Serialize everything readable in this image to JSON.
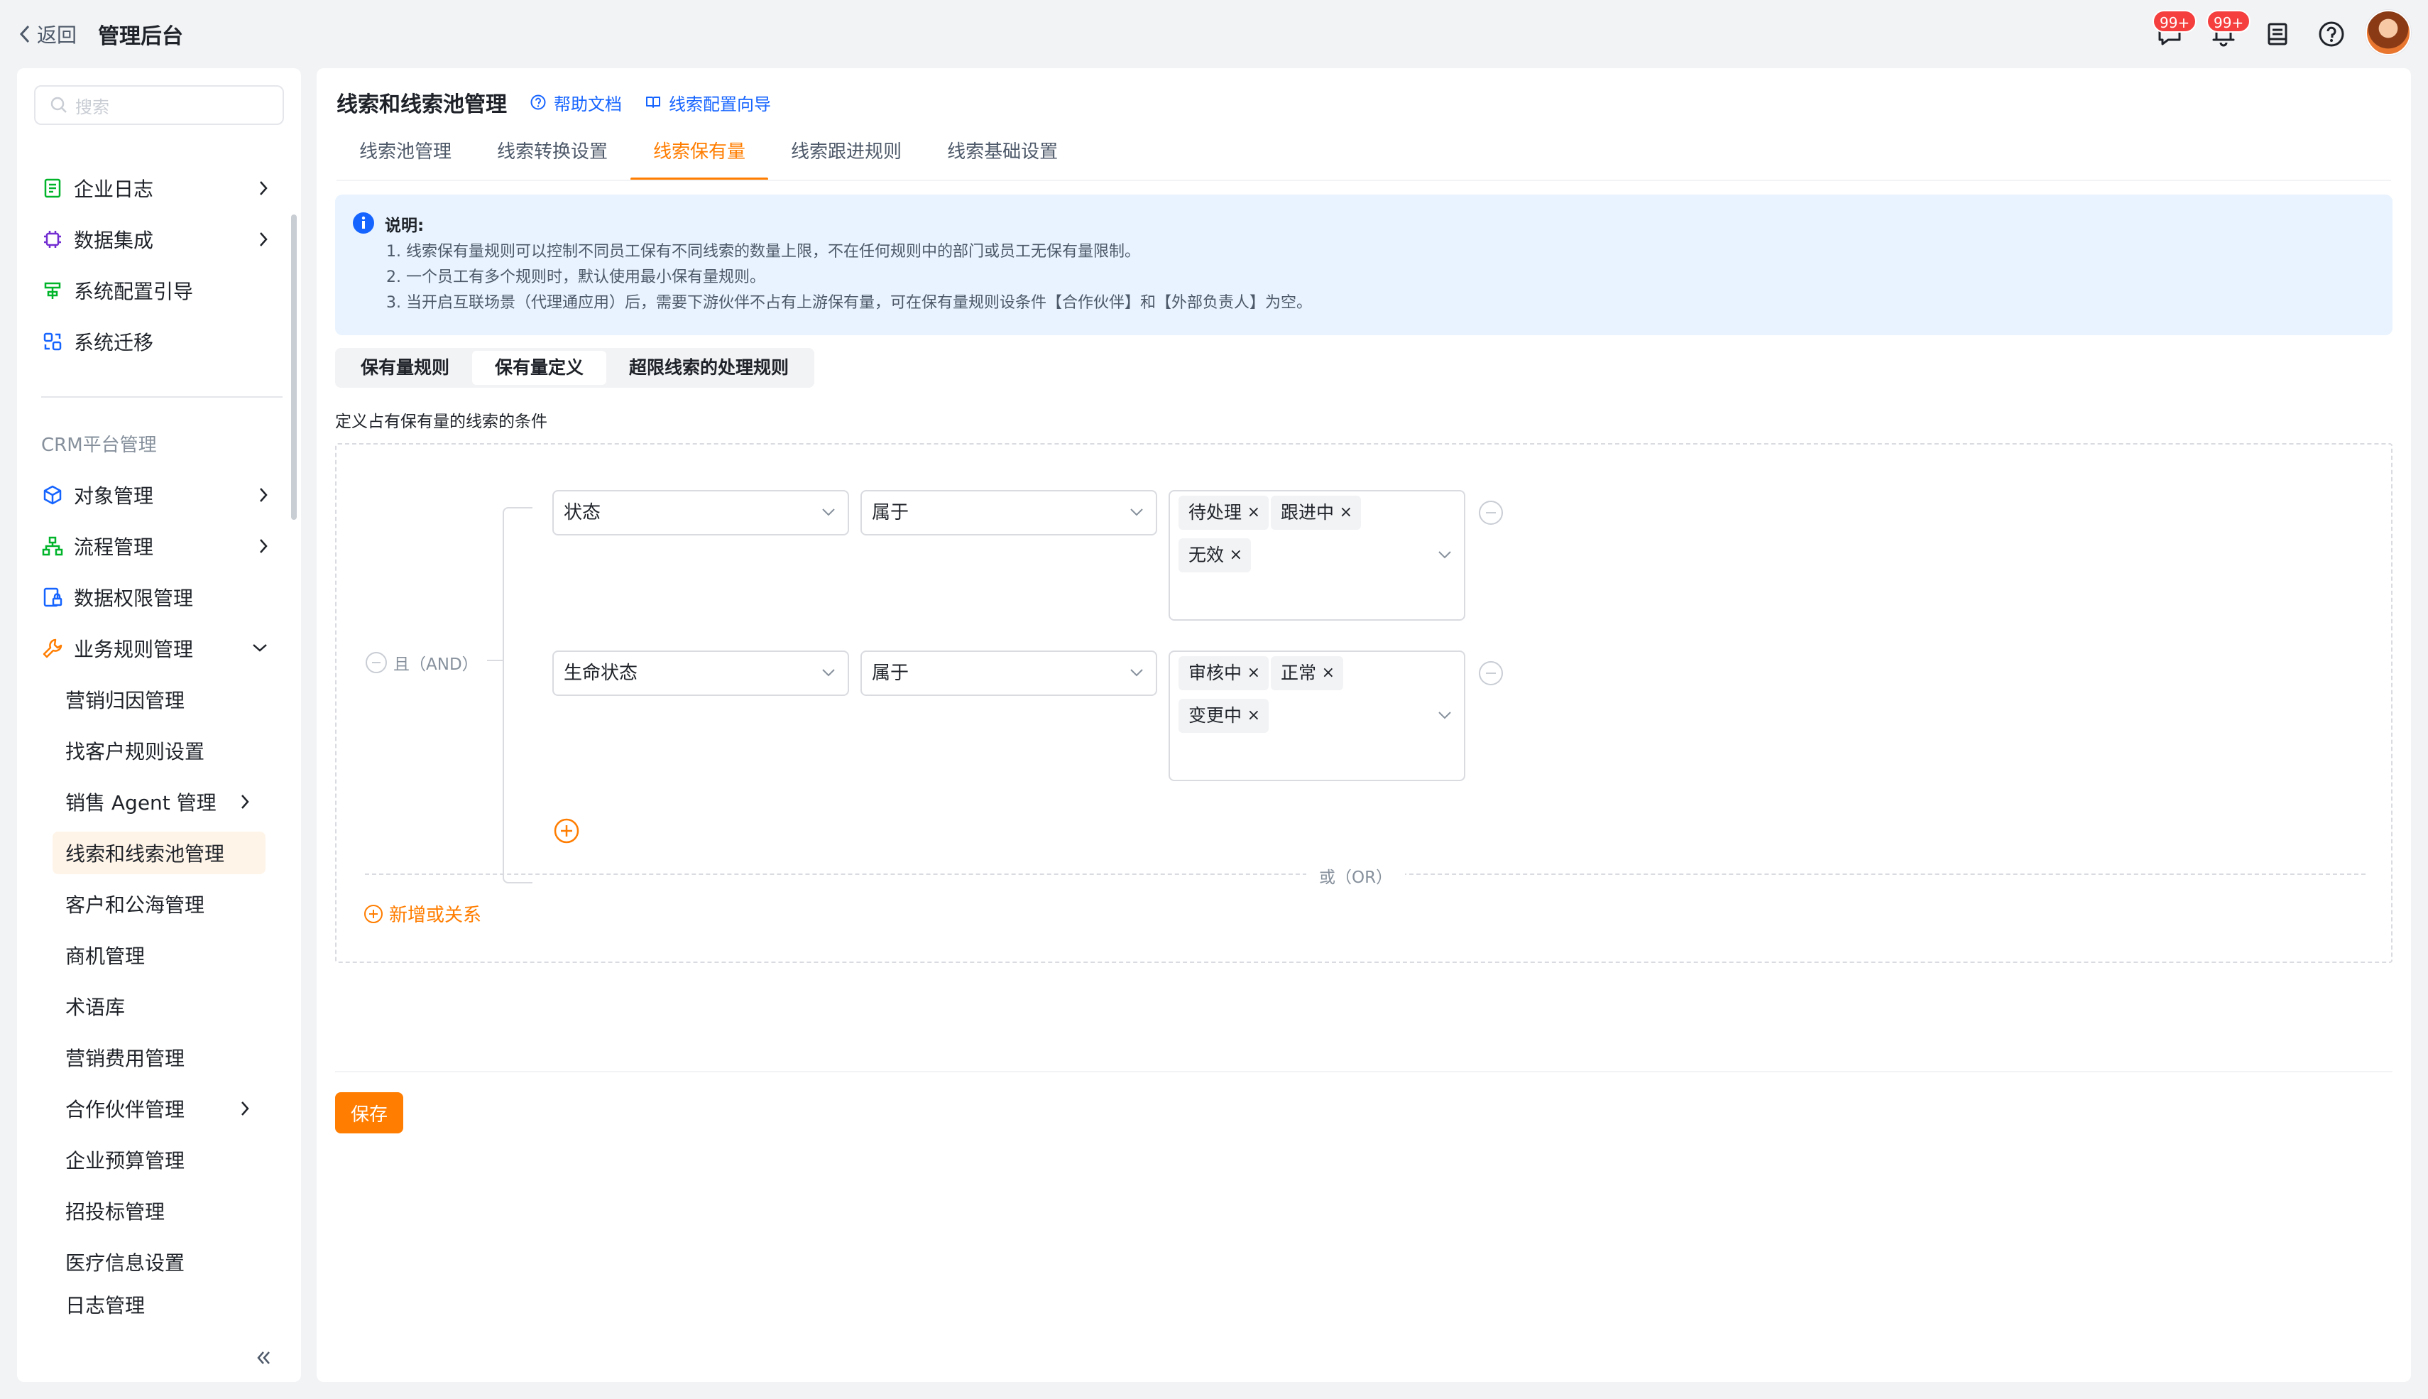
{
  "topbar": {
    "back_label": "返回",
    "app_title": "管理后台",
    "message_badge": "99+",
    "notification_badge": "99+"
  },
  "sidebar": {
    "search_placeholder": "搜索",
    "items_top": [
      {
        "label": "企业日志",
        "icon": "log-icon",
        "has_children": true
      },
      {
        "label": "数据集成",
        "icon": "chip-icon",
        "has_children": true
      },
      {
        "label": "系统配置引导",
        "icon": "guide-icon",
        "has_children": false
      },
      {
        "label": "系统迁移",
        "icon": "migrate-icon",
        "has_children": false
      }
    ],
    "group_label": "CRM平台管理",
    "items_crm": [
      {
        "label": "对象管理",
        "icon": "cube-icon",
        "has_children": true
      },
      {
        "label": "流程管理",
        "icon": "flow-icon",
        "has_children": true
      },
      {
        "label": "数据权限管理",
        "icon": "lock-doc-icon",
        "has_children": false
      },
      {
        "label": "业务规则管理",
        "icon": "wrench-icon",
        "has_children": true,
        "expanded": true
      }
    ],
    "sub_items": [
      {
        "label": "营销归因管理"
      },
      {
        "label": "找客户规则设置"
      },
      {
        "label": "销售 Agent 管理",
        "has_children": true
      },
      {
        "label": "线索和线索池管理",
        "active": true
      },
      {
        "label": "客户和公海管理"
      },
      {
        "label": "商机管理"
      },
      {
        "label": "术语库"
      },
      {
        "label": "营销费用管理"
      },
      {
        "label": "合作伙伴管理",
        "has_children": true
      },
      {
        "label": "企业预算管理"
      },
      {
        "label": "招投标管理"
      },
      {
        "label": "医疗信息设置"
      },
      {
        "label": "日志管理"
      }
    ]
  },
  "page": {
    "title": "线索和线索池管理",
    "help_doc": "帮助文档",
    "config_guide": "线索配置向导",
    "tabs": [
      "线索池管理",
      "线索转换设置",
      "线索保有量",
      "线索跟进规则",
      "线索基础设置"
    ],
    "active_tab": "线索保有量"
  },
  "notice": {
    "title": "说明:",
    "lines": [
      "1. 线索保有量规则可以控制不同员工保有不同线索的数量上限，不在任何规则中的部门或员工无保有量限制。",
      "2. 一个员工有多个规则时，默认使用最小保有量规则。",
      "3. 当开启互联场景（代理通应用）后，需要下游伙伴不占有上游保有量，可在保有量规则设条件【合作伙伴】和【外部负责人】为空。"
    ]
  },
  "segments": [
    "保有量规则",
    "保有量定义",
    "超限线索的处理规则"
  ],
  "active_segment": "保有量定义",
  "conditions": {
    "description": "定义占有保有量的线索的条件",
    "and_label": "且（AND）",
    "rows": [
      {
        "field": "状态",
        "operator": "属于",
        "values": [
          "待处理",
          "跟进中",
          "无效"
        ]
      },
      {
        "field": "生命状态",
        "operator": "属于",
        "values": [
          "审核中",
          "正常",
          "变更中"
        ]
      }
    ],
    "or_label": "或（OR）",
    "add_or_label": "新增或关系"
  },
  "footer": {
    "save_label": "保存"
  },
  "colors": {
    "accent": "#ff7d00",
    "link": "#1664ff",
    "notice_bg": "#e8f3ff",
    "badge": "#f53f3f"
  }
}
